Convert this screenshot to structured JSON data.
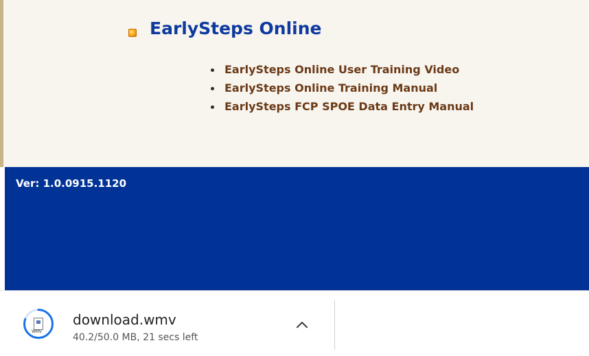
{
  "section": {
    "title": "EarlySteps Online",
    "links": [
      "EarlySteps Online User Training Video",
      "EarlySteps Online Training Manual",
      "EarlySteps FCP SPOE Data Entry Manual"
    ]
  },
  "footer": {
    "version": "Ver: 1.0.0915.1120"
  },
  "download": {
    "file_name": "download.wmv",
    "status": "40.2/50.0 MB, 21 secs left",
    "icon_caption": "WMV",
    "progress_fraction": 0.804
  },
  "colors": {
    "title_blue": "#0e3a9e",
    "link_brown": "#6b3a16",
    "footer_band": "#013397",
    "content_bg": "#f8f5ef",
    "progress_blue": "#1a73e8"
  },
  "icons": {
    "bullet": "orange-square-bullet-icon",
    "file": "wmv-file-icon",
    "expand": "chevron-up-icon"
  }
}
